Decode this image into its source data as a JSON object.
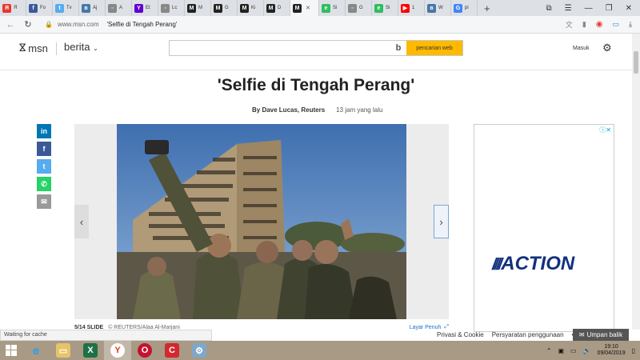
{
  "browser": {
    "tabs": [
      {
        "label": "Я",
        "icon": "yandex-icon",
        "color": "#e8372c",
        "glyph": "Я"
      },
      {
        "label": "Fo",
        "icon": "facebook-icon",
        "color": "#3b5998",
        "glyph": "f"
      },
      {
        "label": "Tv",
        "icon": "twitter-icon",
        "color": "#55acee",
        "glyph": "t"
      },
      {
        "label": "Aj",
        "icon": "vk-icon",
        "color": "#4a76a8",
        "glyph": "в"
      },
      {
        "label": "A",
        "icon": "page-icon",
        "color": "#888888",
        "glyph": "▫"
      },
      {
        "label": "Et",
        "icon": "yahoo-icon",
        "color": "#6001d2",
        "glyph": "Y"
      },
      {
        "label": "Lc",
        "icon": "page-icon",
        "color": "#888888",
        "glyph": "▫"
      },
      {
        "label": "M",
        "icon": "msn-icon",
        "color": "#222222",
        "glyph": "M"
      },
      {
        "label": "G",
        "icon": "msn-icon",
        "color": "#222222",
        "glyph": "M"
      },
      {
        "label": "Ki",
        "icon": "msn-icon",
        "color": "#222222",
        "glyph": "M"
      },
      {
        "label": "D",
        "icon": "msn-icon",
        "color": "#222222",
        "glyph": "M"
      },
      {
        "label": "",
        "icon": "msn-icon",
        "color": "#222222",
        "glyph": "M",
        "active": true
      },
      {
        "label": "Si",
        "icon": "evernote-icon",
        "color": "#2dbe60",
        "glyph": "e"
      },
      {
        "label": "G",
        "icon": "page-icon",
        "color": "#888888",
        "glyph": "▫"
      },
      {
        "label": "Si",
        "icon": "evernote-icon",
        "color": "#2dbe60",
        "glyph": "e"
      },
      {
        "label": "1",
        "icon": "youtube-icon",
        "color": "#ff0000",
        "glyph": "▶"
      },
      {
        "label": "W",
        "icon": "vk-icon",
        "color": "#4a76a8",
        "glyph": "в"
      },
      {
        "label": "pi",
        "icon": "google-icon",
        "color": "#4285f4",
        "glyph": "G"
      }
    ],
    "url_host": "www.msn.com",
    "url_title": "'Selfie di Tengah Perang'"
  },
  "header": {
    "logo": "msn",
    "section": "berita",
    "search_placeholder": "",
    "search_button": "pencarian web",
    "signin": "Masuk"
  },
  "article": {
    "title": "'Selfie di Tengah Perang'",
    "author": "By Dave Lucas, Reuters",
    "time": "13 jam yang lalu"
  },
  "slideshow": {
    "count": "5/14 SLIDE",
    "credit": "© REUTERS/Alaa Al-Marjani",
    "fullscreen": "Layar Penuh"
  },
  "ad": {
    "brand": "ACTION"
  },
  "status": {
    "text": "Waiting for cache"
  },
  "footer": {
    "privacy": "Privasi & Cookie",
    "terms": "Persyaratan penggunaan",
    "dots": "•••",
    "feedback": "Umpan balik"
  },
  "taskbar": {
    "time": "19:10",
    "date": "09/04/2019"
  }
}
